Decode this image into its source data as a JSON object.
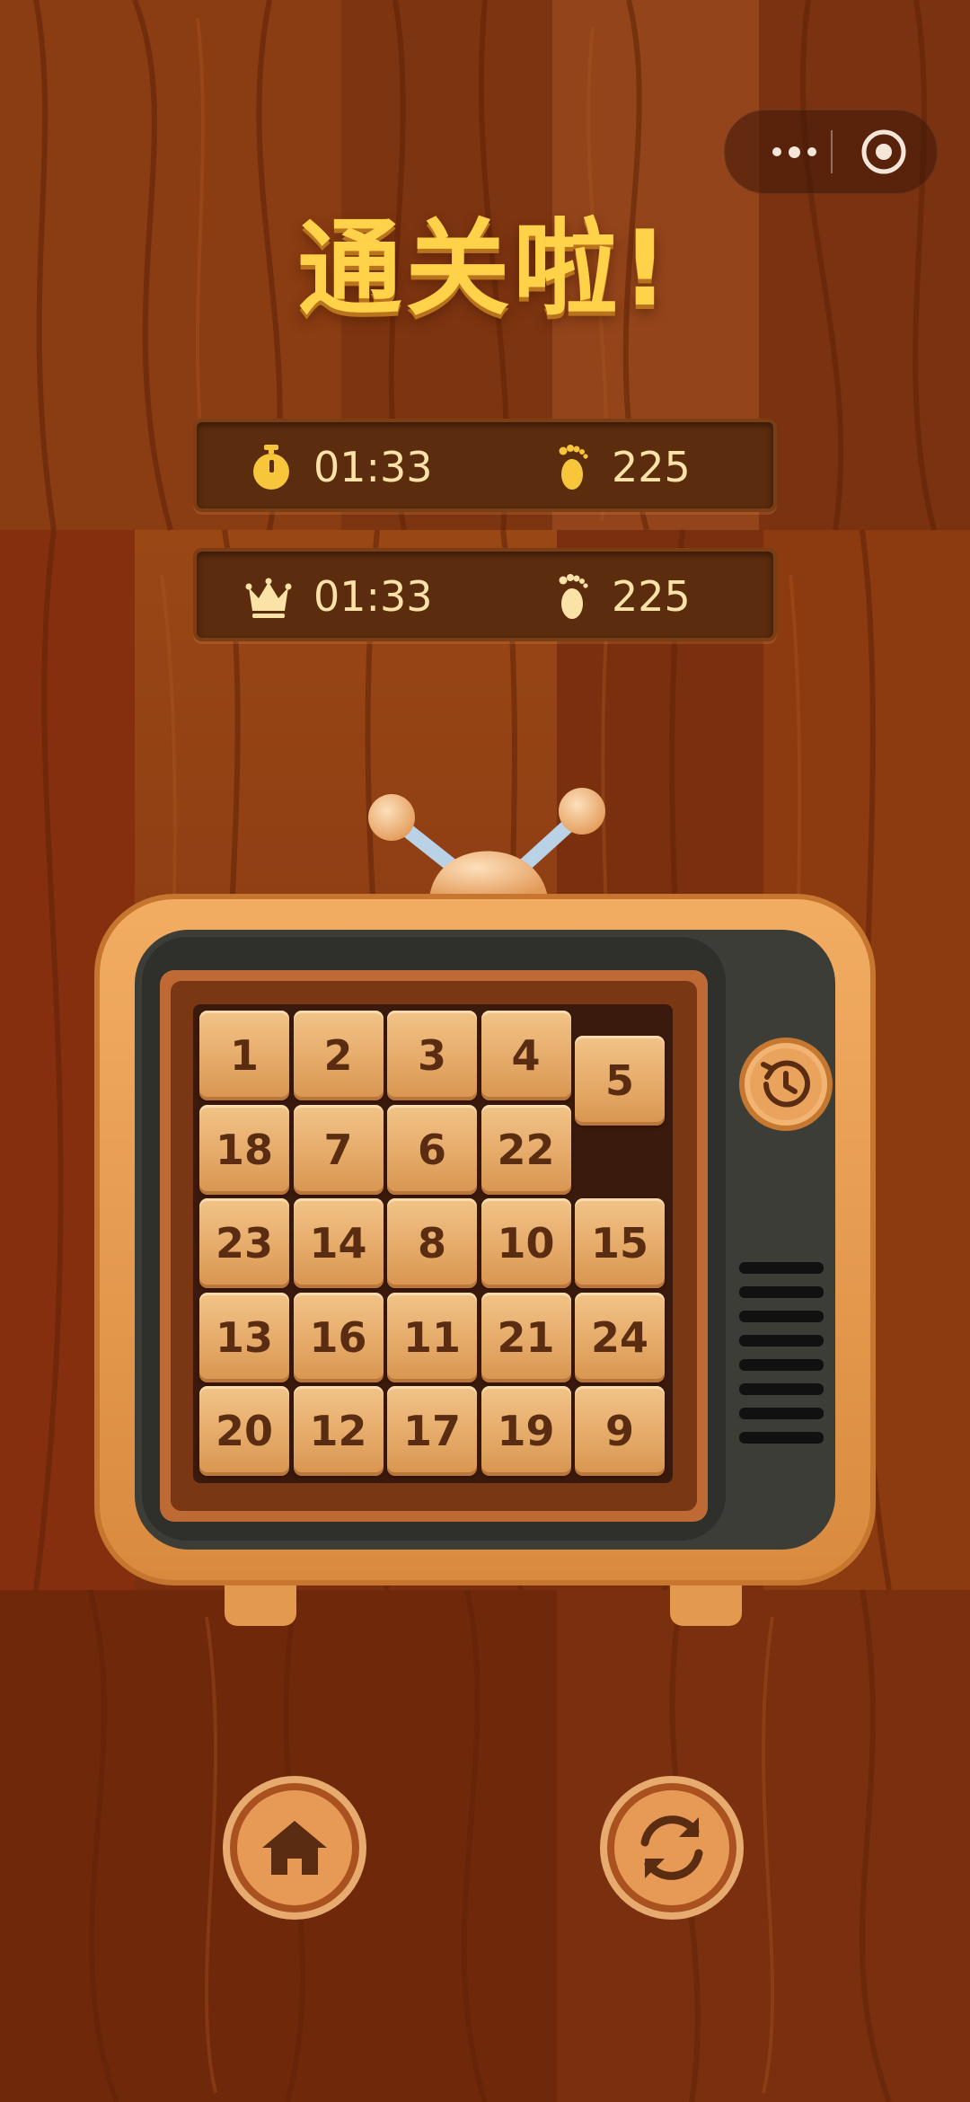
{
  "app": {
    "title": "通关啦!"
  },
  "capsule": {
    "more_icon": "more-dots-icon",
    "close_icon": "target-circle-icon"
  },
  "current_result": {
    "time_icon": "stopwatch-icon",
    "time": "01:33",
    "steps_icon": "footprint-icon",
    "steps": "225"
  },
  "best_result": {
    "time_icon": "crown-icon",
    "time": "01:33",
    "steps_icon": "footprint-icon",
    "steps": "225"
  },
  "board": {
    "size": 5,
    "rows": [
      [
        "1",
        "2",
        "3",
        "4",
        "5"
      ],
      [
        "18",
        "7",
        "6",
        "22",
        ""
      ],
      [
        "23",
        "14",
        "8",
        "10",
        "15"
      ],
      [
        "13",
        "16",
        "11",
        "21",
        "24"
      ],
      [
        "20",
        "12",
        "17",
        "19",
        "9"
      ]
    ],
    "empty_cell": "row 2, column 5"
  },
  "controls": {
    "undo_icon": "history-undo-icon",
    "home_icon": "home-icon",
    "restart_icon": "refresh-icon"
  },
  "colors": {
    "title": "#ffd24a",
    "tile": "#e4a866",
    "tile_text": "#5a2d12",
    "panel": "#5c2c0e",
    "panel_text": "#fbe3a8",
    "tv_frame": "#e39a4e",
    "tv_screen": "#3a3a34"
  }
}
